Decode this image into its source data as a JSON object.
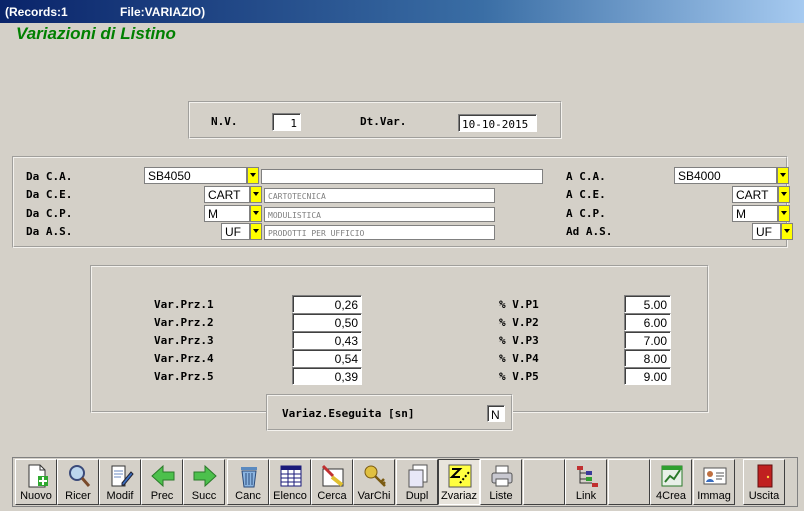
{
  "window": {
    "records": "(Records:1",
    "file": "File:VARIAZIO)"
  },
  "app_title": "Variazioni di Listino",
  "header": {
    "nv_label": "N.V.",
    "nv_value": "1",
    "dt_label": "Dt.Var.",
    "dt_value": "10-10-2015"
  },
  "filters": {
    "da_ca_label": "Da C.A.",
    "da_ca_value": "SB4050",
    "da_ca_desc": "",
    "da_ce_label": "Da C.E.",
    "da_ce_value": "CART",
    "da_ce_desc": "CARTOTECNICA",
    "da_cp_label": "Da C.P.",
    "da_cp_value": "M",
    "da_cp_desc": "MODULISTICA",
    "da_as_label": "Da A.S.",
    "da_as_value": "UF",
    "da_as_desc": "PRODOTTI PER UFFICIO",
    "a_ca_label": "A C.A.",
    "a_ca_value": "SB4000",
    "a_ce_label": "A C.E.",
    "a_ce_value": "CART",
    "a_cp_label": "A C.P.",
    "a_cp_value": "M",
    "ad_as_label": "Ad A.S.",
    "ad_as_value": "UF"
  },
  "prices": {
    "var": [
      {
        "label": "Var.Prz.1",
        "value": "0,26"
      },
      {
        "label": "Var.Prz.2",
        "value": "0,50"
      },
      {
        "label": "Var.Prz.3",
        "value": "0,43"
      },
      {
        "label": "Var.Prz.4",
        "value": "0,54"
      },
      {
        "label": "Var.Prz.5",
        "value": "0,39"
      }
    ],
    "perc": [
      {
        "label": "% V.P1",
        "value": "5.00"
      },
      {
        "label": "% V.P2",
        "value": "6.00"
      },
      {
        "label": "% V.P3",
        "value": "7.00"
      },
      {
        "label": "% V.P4",
        "value": "8.00"
      },
      {
        "label": "% V.P5",
        "value": "9.00"
      }
    ],
    "eseguita_label": "Variaz.Eseguita [sn]",
    "eseguita_value": "N"
  },
  "toolbar": {
    "nuovo": "Nuovo",
    "ricer": "Ricer",
    "modif": "Modif",
    "prec": "Prec",
    "succ": "Succ",
    "canc": "Canc",
    "elenco": "Elenco",
    "cerca": "Cerca",
    "varchi": "VarChi",
    "dupl": "Dupl",
    "zvariaz": "Zvariaz",
    "liste": "Liste",
    "link": "Link",
    "crea4": "4Crea",
    "immag": "Immag",
    "uscita": "Uscita"
  },
  "colors": {
    "accent_title": "#008000",
    "dropdown": "#ffff00",
    "titlebar": "#0a246a"
  }
}
